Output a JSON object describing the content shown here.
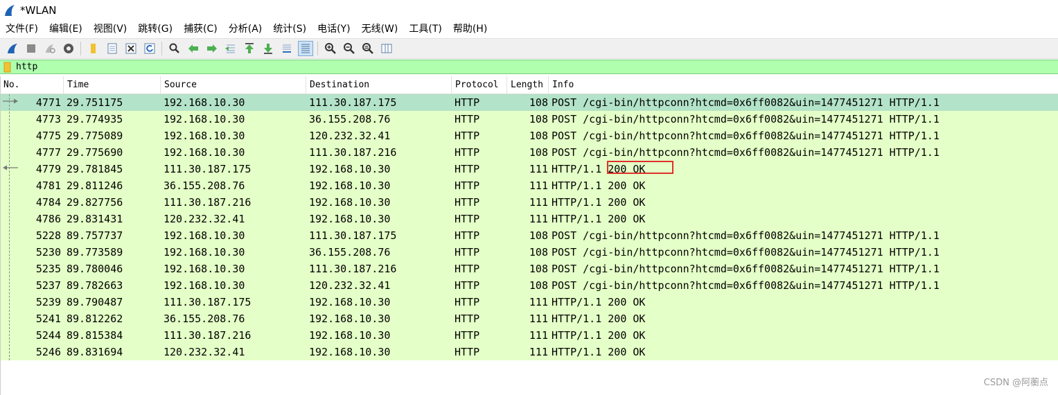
{
  "window": {
    "title": "*WLAN"
  },
  "menu": [
    "文件(F)",
    "编辑(E)",
    "视图(V)",
    "跳转(G)",
    "捕获(C)",
    "分析(A)",
    "统计(S)",
    "电话(Y)",
    "无线(W)",
    "工具(T)",
    "帮助(H)"
  ],
  "filter": {
    "value": "http"
  },
  "columns": {
    "no": "No.",
    "time": "Time",
    "source": "Source",
    "destination": "Destination",
    "protocol": "Protocol",
    "length": "Length",
    "info": "Info"
  },
  "packets": [
    {
      "no": "4771",
      "time": "29.751175",
      "source": "192.168.10.30",
      "destination": "111.30.187.175",
      "protocol": "HTTP",
      "length": "108",
      "info": "POST /cgi-bin/httpconn?htcmd=0x6ff0082&uin=1477451271 HTTP/1.1"
    },
    {
      "no": "4773",
      "time": "29.774935",
      "source": "192.168.10.30",
      "destination": "36.155.208.76",
      "protocol": "HTTP",
      "length": "108",
      "info": "POST /cgi-bin/httpconn?htcmd=0x6ff0082&uin=1477451271 HTTP/1.1"
    },
    {
      "no": "4775",
      "time": "29.775089",
      "source": "192.168.10.30",
      "destination": "120.232.32.41",
      "protocol": "HTTP",
      "length": "108",
      "info": "POST /cgi-bin/httpconn?htcmd=0x6ff0082&uin=1477451271 HTTP/1.1"
    },
    {
      "no": "4777",
      "time": "29.775690",
      "source": "192.168.10.30",
      "destination": "111.30.187.216",
      "protocol": "HTTP",
      "length": "108",
      "info": "POST /cgi-bin/httpconn?htcmd=0x6ff0082&uin=1477451271 HTTP/1.1"
    },
    {
      "no": "4779",
      "time": "29.781845",
      "source": "111.30.187.175",
      "destination": "192.168.10.30",
      "protocol": "HTTP",
      "length": "111",
      "info": "HTTP/1.1 200 OK"
    },
    {
      "no": "4781",
      "time": "29.811246",
      "source": "36.155.208.76",
      "destination": "192.168.10.30",
      "protocol": "HTTP",
      "length": "111",
      "info": "HTTP/1.1 200 OK"
    },
    {
      "no": "4784",
      "time": "29.827756",
      "source": "111.30.187.216",
      "destination": "192.168.10.30",
      "protocol": "HTTP",
      "length": "111",
      "info": "HTTP/1.1 200 OK"
    },
    {
      "no": "4786",
      "time": "29.831431",
      "source": "120.232.32.41",
      "destination": "192.168.10.30",
      "protocol": "HTTP",
      "length": "111",
      "info": "HTTP/1.1 200 OK"
    },
    {
      "no": "5228",
      "time": "89.757737",
      "source": "192.168.10.30",
      "destination": "111.30.187.175",
      "protocol": "HTTP",
      "length": "108",
      "info": "POST /cgi-bin/httpconn?htcmd=0x6ff0082&uin=1477451271 HTTP/1.1"
    },
    {
      "no": "5230",
      "time": "89.773589",
      "source": "192.168.10.30",
      "destination": "36.155.208.76",
      "protocol": "HTTP",
      "length": "108",
      "info": "POST /cgi-bin/httpconn?htcmd=0x6ff0082&uin=1477451271 HTTP/1.1"
    },
    {
      "no": "5235",
      "time": "89.780046",
      "source": "192.168.10.30",
      "destination": "111.30.187.216",
      "protocol": "HTTP",
      "length": "108",
      "info": "POST /cgi-bin/httpconn?htcmd=0x6ff0082&uin=1477451271 HTTP/1.1"
    },
    {
      "no": "5237",
      "time": "89.782663",
      "source": "192.168.10.30",
      "destination": "120.232.32.41",
      "protocol": "HTTP",
      "length": "108",
      "info": "POST /cgi-bin/httpconn?htcmd=0x6ff0082&uin=1477451271 HTTP/1.1"
    },
    {
      "no": "5239",
      "time": "89.790487",
      "source": "111.30.187.175",
      "destination": "192.168.10.30",
      "protocol": "HTTP",
      "length": "111",
      "info": "HTTP/1.1 200 OK"
    },
    {
      "no": "5241",
      "time": "89.812262",
      "source": "36.155.208.76",
      "destination": "192.168.10.30",
      "protocol": "HTTP",
      "length": "111",
      "info": "HTTP/1.1 200 OK"
    },
    {
      "no": "5244",
      "time": "89.815384",
      "source": "111.30.187.216",
      "destination": "192.168.10.30",
      "protocol": "HTTP",
      "length": "111",
      "info": "HTTP/1.1 200 OK"
    },
    {
      "no": "5246",
      "time": "89.831694",
      "source": "120.232.32.41",
      "destination": "192.168.10.30",
      "protocol": "HTTP",
      "length": "111",
      "info": "HTTP/1.1 200 OK"
    }
  ],
  "selected_packet": "4771",
  "watermark": "CSDN @阿蘅点",
  "colors": {
    "row_http": "#e4ffc7",
    "row_selected": "#b3e3c8",
    "filter_valid": "#afffaf",
    "annotation": "#e0302b"
  }
}
